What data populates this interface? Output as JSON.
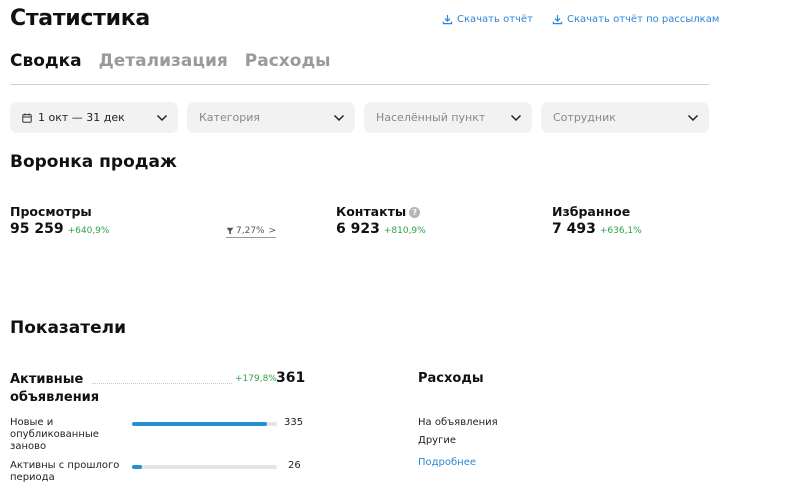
{
  "page": {
    "title": "Статистика",
    "download_report": "Скачать отчёт",
    "download_mailing_report": "Скачать отчёт по рассылкам"
  },
  "tabs": [
    {
      "label": "Сводка",
      "active": true
    },
    {
      "label": "Детализация",
      "active": false
    },
    {
      "label": "Расходы",
      "active": false
    }
  ],
  "filters": {
    "period": "1 окт — 31 дек",
    "category": "Категория",
    "city": "Населённый пункт",
    "employee": "Сотрудник"
  },
  "funnel": {
    "title": "Воронка продаж",
    "views": {
      "label": "Просмотры",
      "value": "95 259",
      "delta": "+640,9%"
    },
    "conversion": "7,27%",
    "contacts": {
      "label": "Контакты",
      "help": "?",
      "value": "6 923",
      "delta": "+810,9%"
    },
    "favorites": {
      "label": "Избранное",
      "value": "7 493",
      "delta": "+636,1%"
    }
  },
  "indicators": {
    "title": "Показатели",
    "active_ads": {
      "label": "Активные объявления",
      "delta": "+179,8%",
      "value": "361",
      "rows": [
        {
          "label": "Новые и опубликованные заново",
          "value": "335",
          "fill": 0.93
        },
        {
          "label": "Активны с прошлого периода",
          "value": "26",
          "fill": 0.07
        }
      ]
    },
    "expenses": {
      "title": "Расходы",
      "items": [
        "На объявления",
        "Другие"
      ],
      "more": "Подробнее"
    }
  },
  "colors": {
    "accent": "#2a86d6",
    "positive": "#2fa34a",
    "bar": "#2590d1"
  }
}
